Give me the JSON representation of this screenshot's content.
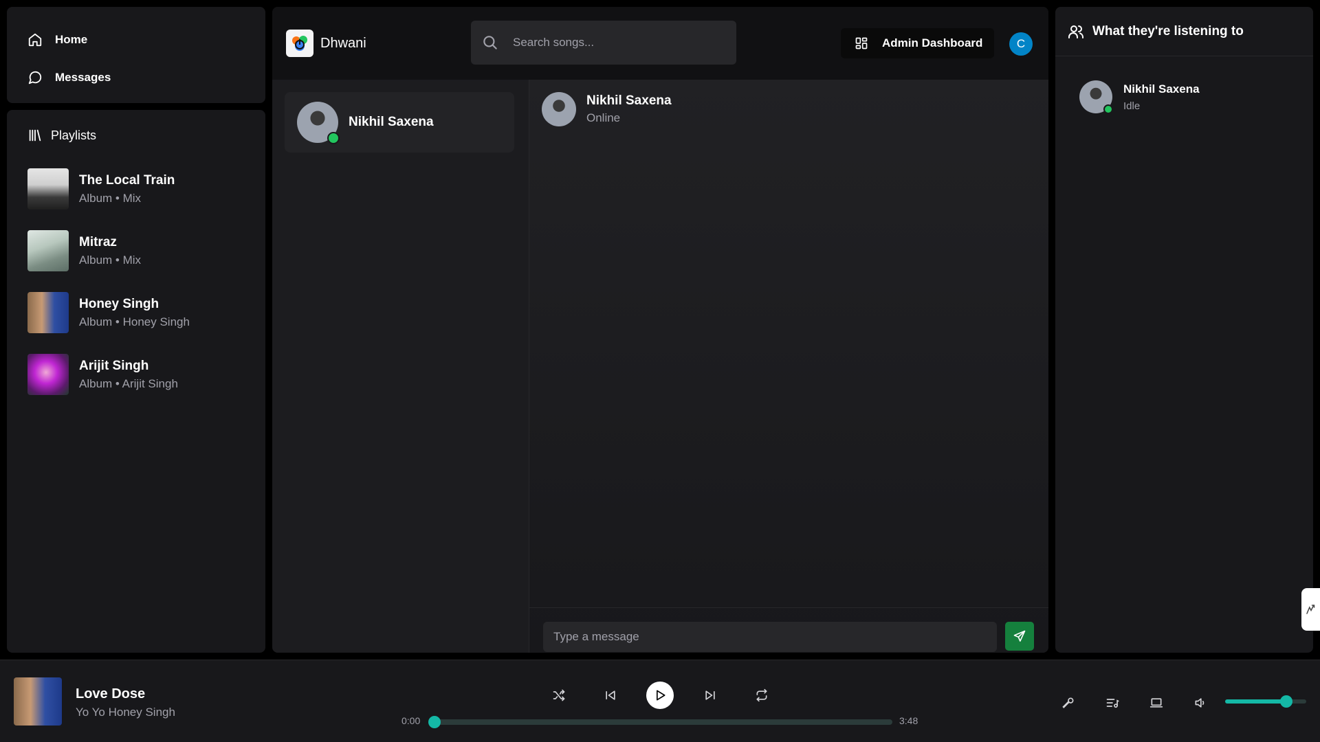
{
  "nav": {
    "home_label": "Home",
    "messages_label": "Messages"
  },
  "playlists": {
    "heading": "Playlists",
    "items": [
      {
        "title": "The Local Train",
        "subtitle": "Album • Mix"
      },
      {
        "title": "Mitraz",
        "subtitle": "Album • Mix"
      },
      {
        "title": "Honey Singh",
        "subtitle": "Album • Honey Singh"
      },
      {
        "title": "Arijit Singh",
        "subtitle": "Album • Arijit Singh"
      }
    ]
  },
  "header": {
    "brand": "Dhwani",
    "search_placeholder": "Search songs...",
    "admin_label": "Admin Dashboard",
    "avatar_initial": "C"
  },
  "users": [
    {
      "name": "Nikhil Saxena",
      "online": true
    }
  ],
  "chat": {
    "contact_name": "Nikhil Saxena",
    "contact_status": "Online",
    "input_placeholder": "Type a message"
  },
  "friends": {
    "heading": "What they're listening to",
    "items": [
      {
        "name": "Nikhil Saxena",
        "status": "Idle"
      }
    ]
  },
  "player": {
    "title": "Love Dose",
    "artist": "Yo Yo Honey Singh",
    "current_time": "0:00",
    "duration": "3:48",
    "progress": 0.0,
    "volume": 0.75
  },
  "colors": {
    "accent": "#14b8a6",
    "online": "#22c55e",
    "send": "#15803d",
    "avatar": "#0284c7"
  }
}
